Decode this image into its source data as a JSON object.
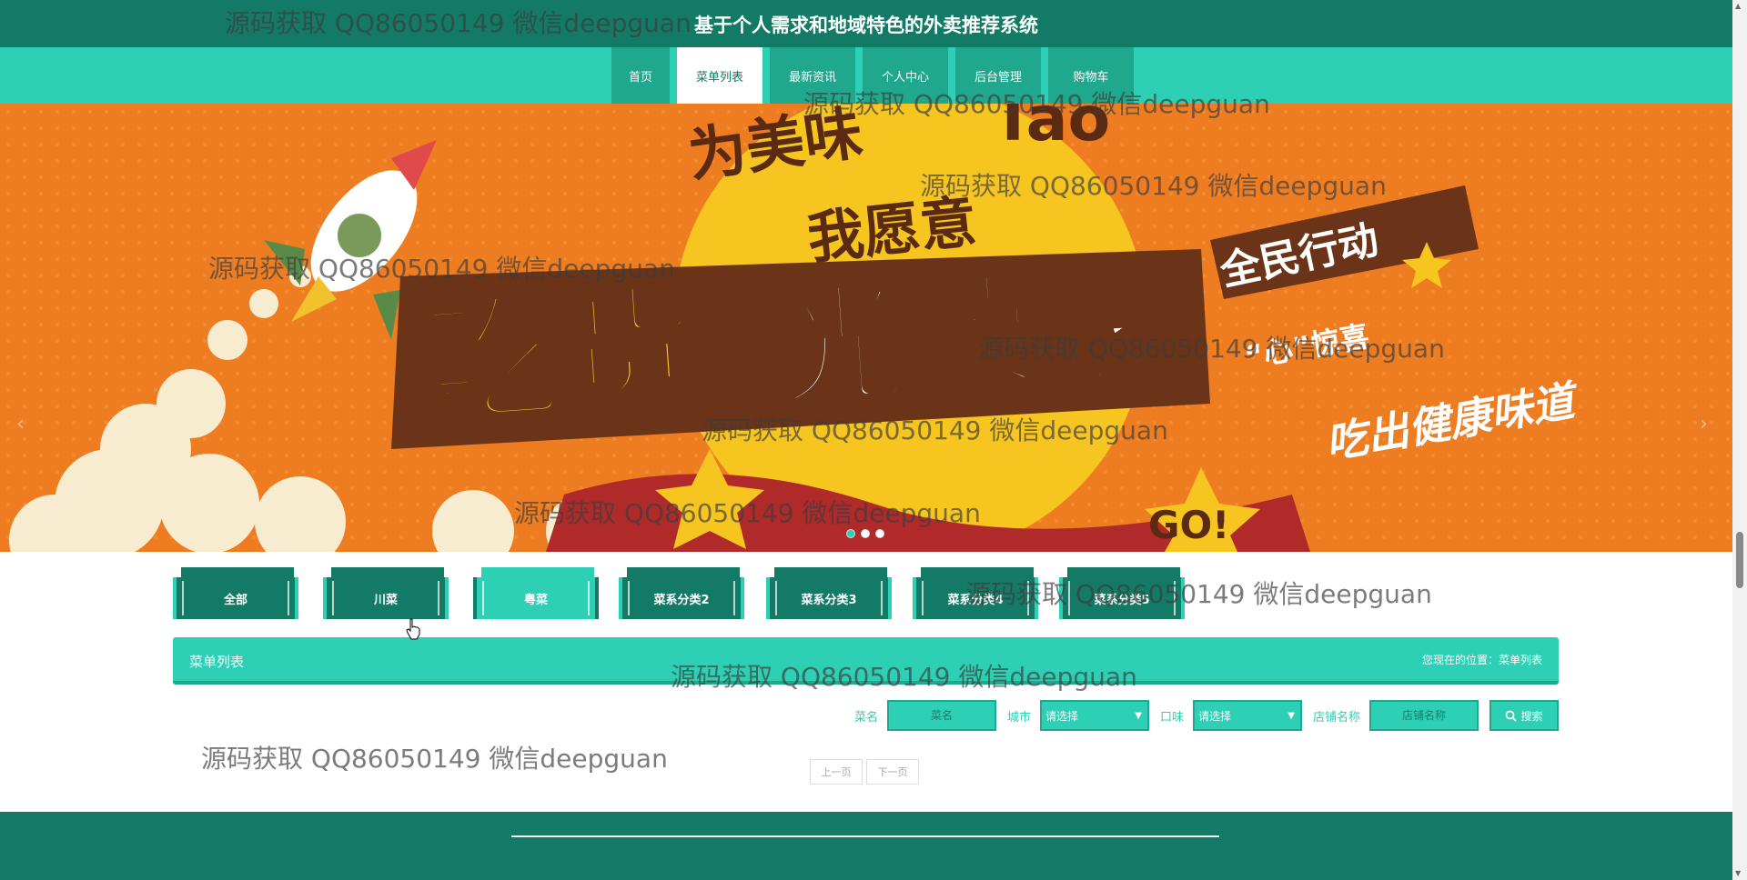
{
  "site_title": "基于个人需求和地域特色的外卖推荐系统",
  "nav": [
    {
      "label": "首页",
      "active": false
    },
    {
      "label": "菜单列表",
      "active": true
    },
    {
      "label": "最新资讯",
      "active": false
    },
    {
      "label": "个人中心",
      "active": false
    },
    {
      "label": "后台管理",
      "active": false
    },
    {
      "label": "购物车",
      "active": false
    }
  ],
  "banner": {
    "headline_top": "为美味",
    "headline_mid": "我愿意",
    "main_left": "吃货",
    "main_right": "光荣季",
    "ribbon": "全民行动",
    "surprise": "“心”惊喜",
    "slogan": "吃出健康味道",
    "go_text": "GO!",
    "logo_text": "Tao",
    "colors": {
      "bg": "#ee7d22",
      "sun": "#f6c520",
      "ribbon": "#b02a2a"
    }
  },
  "carousel": {
    "prev_icon": "‹",
    "next_icon": "›",
    "dots": 3,
    "active_dot": 0
  },
  "categories": [
    {
      "label": "全部",
      "active": false
    },
    {
      "label": "川菜",
      "active": false
    },
    {
      "label": "粤菜",
      "active": true
    },
    {
      "label": "菜系分类2",
      "active": false
    },
    {
      "label": "菜系分类3",
      "active": false
    },
    {
      "label": "菜系分类4",
      "active": false
    },
    {
      "label": "菜系分类5",
      "active": false
    }
  ],
  "section": {
    "title": "菜单列表",
    "location_label": "您现在的位置：",
    "location_value": "菜单列表"
  },
  "search": {
    "name_label": "菜名",
    "name_placeholder": "菜名",
    "city_label": "城市",
    "city_value": "请选择",
    "taste_label": "口味",
    "taste_value": "请选择",
    "shop_label": "店铺名称",
    "shop_placeholder": "店铺名称",
    "button_label": "搜索",
    "button_icon": "search-icon"
  },
  "pager": {
    "prev": "上一页",
    "next": "下一页"
  },
  "watermark_text": "源码获取 QQ86050149 微信deepguan",
  "colors": {
    "dark_teal": "#137a66",
    "teal": "#2dd0b4",
    "mid_teal": "#20a88e"
  }
}
